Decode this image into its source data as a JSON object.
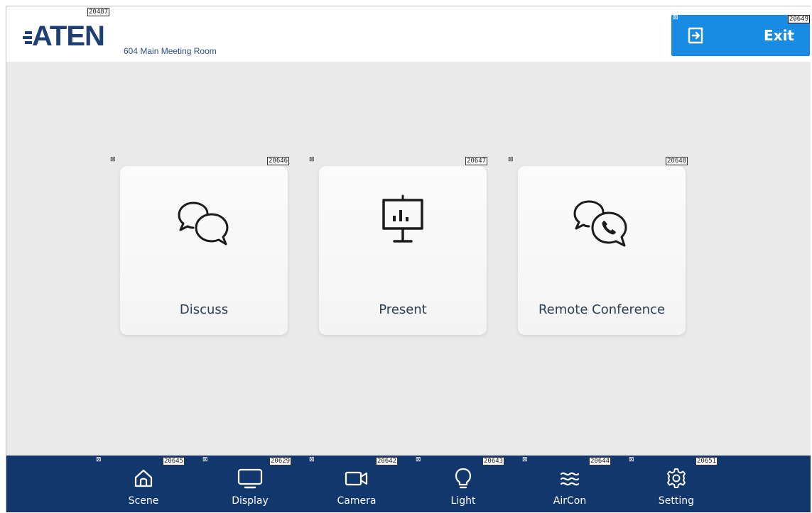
{
  "header": {
    "logo_text": "ATEN",
    "room_name": "604 Main Meeting Room",
    "exit_label": "Exit",
    "logo_tag": "20487",
    "exit_tag": "20649"
  },
  "cards": [
    {
      "label": "Discuss",
      "icon": "discuss-chat-bubbles-icon",
      "tag": "20646"
    },
    {
      "label": "Present",
      "icon": "presentation-board-icon",
      "tag": "20647"
    },
    {
      "label": "Remote Conference",
      "icon": "chat-phone-icon",
      "tag": "20648"
    }
  ],
  "nav": [
    {
      "label": "Scene",
      "icon": "home-icon",
      "tag": "20645"
    },
    {
      "label": "Display",
      "icon": "monitor-icon",
      "tag": "20629"
    },
    {
      "label": "Camera",
      "icon": "video-camera-icon",
      "tag": "20642"
    },
    {
      "label": "Light",
      "icon": "light-bulb-icon",
      "tag": "20643"
    },
    {
      "label": "AirCon",
      "icon": "air-waves-icon",
      "tag": "20644"
    },
    {
      "label": "Setting",
      "icon": "gear-icon",
      "tag": "20651"
    }
  ],
  "colors": {
    "accent_blue": "#1a8be3",
    "nav_bg": "#12376c",
    "logo_navy": "#1f3f74",
    "background": "#eaeaea"
  }
}
